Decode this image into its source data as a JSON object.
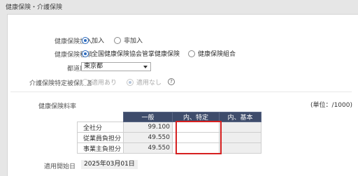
{
  "section": {
    "title": "健康保険・介護保険"
  },
  "health_insurance": {
    "label": "健康保険加入",
    "options": [
      {
        "label": "加入",
        "checked": true
      },
      {
        "label": "非加入",
        "checked": false
      }
    ]
  },
  "insurance_type": {
    "label": "健康保険種類",
    "options": [
      {
        "label": "全国健康保険協会管掌健康保険",
        "checked": true
      },
      {
        "label": "健康保険組合",
        "checked": false
      }
    ]
  },
  "prefecture": {
    "label": "都道府県",
    "selected": "東京都"
  },
  "care_insurance": {
    "label": "介護保険特定被保険者",
    "options": [
      {
        "label": "適用あり",
        "checked": false,
        "disabled": true
      },
      {
        "label": "適用なし",
        "checked": true,
        "disabled": true
      }
    ],
    "help_icon": "question-circle-icon"
  },
  "rates": {
    "label": "健康保険料率",
    "unit": "(単位：/1000)",
    "headers": [
      "一般",
      "内、特定",
      "内、基本"
    ],
    "rows": [
      {
        "label": "全社分",
        "general": "99.100",
        "specific": "",
        "basic": ""
      },
      {
        "label": "従業員負担分",
        "general": "49.550",
        "specific": "",
        "basic": ""
      },
      {
        "label": "事業主負担分",
        "general": "49.550",
        "specific": "",
        "basic": ""
      }
    ]
  },
  "start_date": {
    "label": "適用開始日",
    "value": "2025年03月01日"
  },
  "colors": {
    "table_header": "#3e4c6b",
    "radio_accent": "#2d6cc0",
    "highlight_box": "#d62020"
  }
}
